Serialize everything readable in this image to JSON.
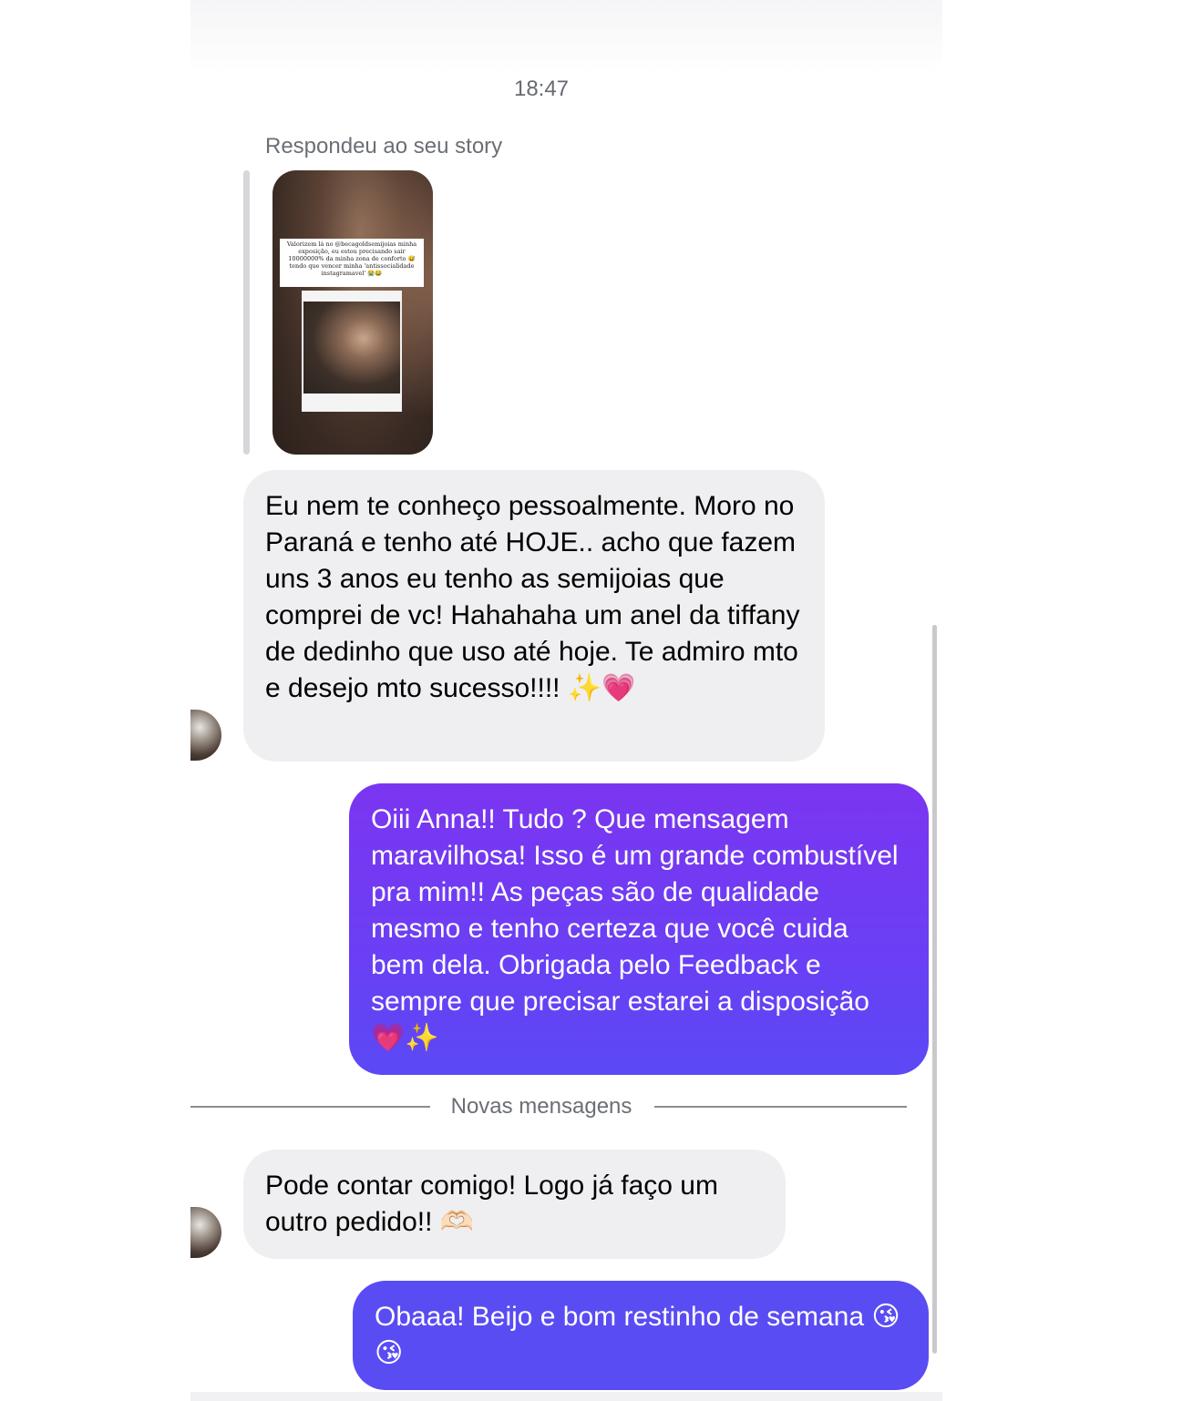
{
  "timestamp": "18:47",
  "story_reply": {
    "label": "Respondeu ao seu story",
    "caption": "Valorizem lá no @becagoldsemijoias minha exposição, eu estou precisando sair 10000000% da minha zona de conforto 😅 tendo que vencer minha 'antissocialidade instagramavel' 😭😂"
  },
  "messages": [
    {
      "direction": "incoming",
      "text": "Eu nem te conheço pessoalmente. Moro no Paraná e tenho até HOJE.. acho que fazem uns 3 anos eu tenho as semijoias que comprei de vc! Hahahaha um anel da tiffany de dedinho que uso até hoje. Te admiro mto e desejo mto sucesso!!!! ✨💗"
    },
    {
      "direction": "outgoing",
      "text": "Oiii Anna!! Tudo ? Que mensagem maravilhosa! Isso é um grande combustível pra mim!! As peças são de qualidade mesmo e tenho certeza que você cuida bem dela. Obrigada pelo Feedback e sempre que precisar estarei a disposição 💗✨"
    },
    {
      "direction": "incoming",
      "text": "Pode contar comigo! Logo já faço um outro pedido!! 🫶🏻"
    },
    {
      "direction": "outgoing",
      "text": "Obaaa! Beijo e bom restinho de semana 😘😘"
    }
  ],
  "divider_label": "Novas mensagens",
  "colors": {
    "incoming_bubble": "#efeff1",
    "outgoing_gradient_top": "#7b35f0",
    "outgoing_gradient_bottom": "#5b49f5"
  },
  "icons": [
    "sender-avatar"
  ]
}
